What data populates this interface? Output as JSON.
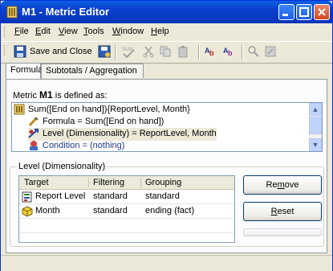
{
  "window": {
    "title": "M1 - Metric Editor"
  },
  "menu": [
    {
      "label": "File",
      "key": "F",
      "rest": "ile"
    },
    {
      "label": "Edit",
      "key": "E",
      "rest": "dit"
    },
    {
      "label": "View",
      "key": "V",
      "rest": "iew"
    },
    {
      "label": "Tools",
      "key": "T",
      "rest": "ools"
    },
    {
      "label": "Window",
      "key": "W",
      "rest": "indow"
    },
    {
      "label": "Help",
      "key": "H",
      "rest": "elp"
    }
  ],
  "toolbar": {
    "save_close_label": "Save and Close",
    "sum_icon_text": "SUM"
  },
  "tabs": [
    {
      "label": "Formula"
    },
    {
      "label": "Subtotals / Aggregation"
    }
  ],
  "definition": {
    "prefix": "Metric",
    "metric_name": "M1",
    "suffix": "is defined as:"
  },
  "tree": [
    {
      "text": "Sum([End on hand]){ReportLevel, Month}",
      "icon": "metric-icon"
    },
    {
      "text": "Formula = Sum([End on hand])",
      "icon": "formula-icon"
    },
    {
      "text": "Level (Dimensionality) = ReportLevel, Month",
      "icon": "level-icon"
    },
    {
      "text": "Condition = (nothing)",
      "icon": "condition-icon"
    }
  ],
  "level_group": {
    "title": "Level (Dimensionality)",
    "columns": [
      "Target",
      "Filtering",
      "Grouping"
    ],
    "rows": [
      {
        "target": "Report Level",
        "filtering": "standard",
        "grouping": "standard",
        "icon": "report-level-icon"
      },
      {
        "target": "Month",
        "filtering": "standard",
        "grouping": "ending (fact)",
        "icon": "attribute-cube-icon"
      }
    ],
    "remove_button": {
      "label": "Remove",
      "key": "v"
    },
    "reset_button": {
      "label": "Reset",
      "key": "R"
    }
  }
}
